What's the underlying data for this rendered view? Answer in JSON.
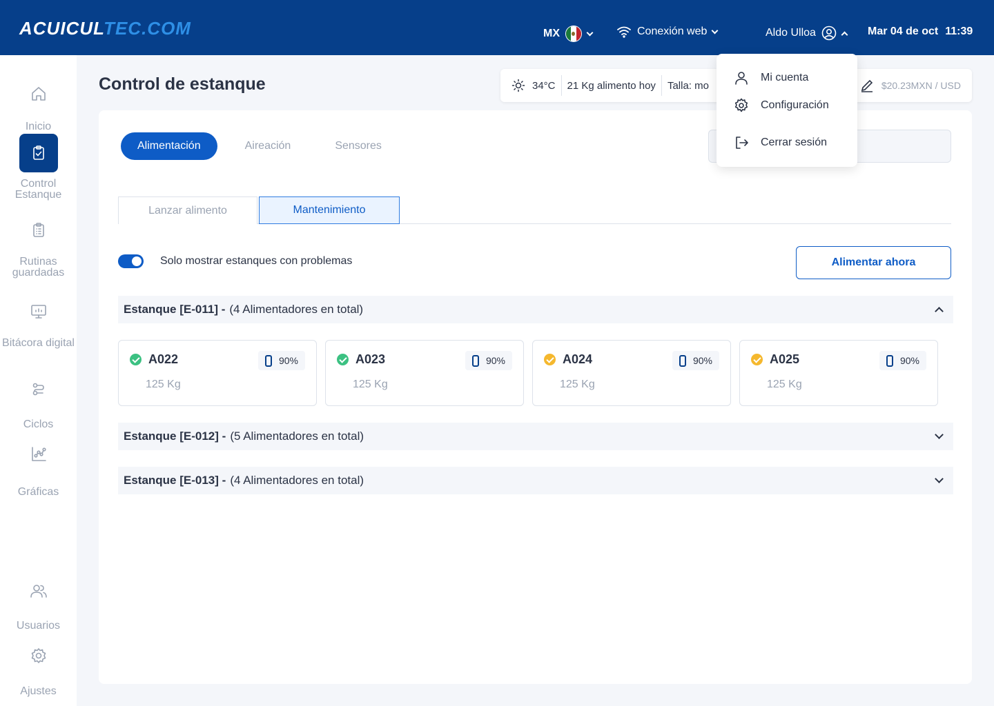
{
  "brand": {
    "logo_part1": "ACUICUL",
    "logo_part2": "TEC.COM"
  },
  "topbar": {
    "country": "MX",
    "connection": "Conexión web",
    "user": "Aldo Ulloa",
    "date": "Mar 04 de oct",
    "time": "11:39"
  },
  "sidebar": {
    "items": [
      {
        "label": "Inicio",
        "icon": "home-icon"
      },
      {
        "label": "Control Estanque",
        "icon": "clipboard-check-icon"
      },
      {
        "label": "Rutinas guardadas",
        "icon": "clipboard-list-icon"
      },
      {
        "label": "Bitácora digital",
        "icon": "monitor-icon"
      },
      {
        "label": "Ciclos",
        "icon": "route-icon"
      },
      {
        "label": "Gráficas",
        "icon": "chart-icon"
      },
      {
        "label": "Usuarios",
        "icon": "users-icon"
      },
      {
        "label": "Ajustes",
        "icon": "gear-icon"
      }
    ]
  },
  "page": {
    "title": "Control de estanque"
  },
  "info_bar": {
    "temperature": "34°C",
    "food_today": "21 Kg alimento hoy",
    "size": "Talla: mo",
    "exchange": "$20.23MXN / USD"
  },
  "tabs": {
    "feeding": "Alimentación",
    "aeration": "Aireación",
    "sensors": "Sensores"
  },
  "sub_tabs": {
    "launch": "Lanzar alimento",
    "maintenance": "Mantenimiento"
  },
  "filter": {
    "label": "Solo mostrar estanques con problemas",
    "enabled": true
  },
  "feed_now_button": "Alimentar ahora",
  "ponds": [
    {
      "id": "Estanque [E-011] -",
      "count": "(4 Alimentadores en total)",
      "expanded": true
    },
    {
      "id": "Estanque [E-012] -",
      "count": "(5 Alimentadores en total)",
      "expanded": false
    },
    {
      "id": "Estanque [E-013] -",
      "count": "(4 Alimentadores en total)",
      "expanded": false
    }
  ],
  "feeders": [
    {
      "name": "A022",
      "weight": "125 Kg",
      "battery": "90%",
      "status": "ok"
    },
    {
      "name": "A023",
      "weight": "125 Kg",
      "battery": "90%",
      "status": "ok"
    },
    {
      "name": "A024",
      "weight": "125 Kg",
      "battery": "90%",
      "status": "warning"
    },
    {
      "name": "A025",
      "weight": "125 Kg",
      "battery": "90%",
      "status": "warning"
    }
  ],
  "user_menu": {
    "account": "Mi cuenta",
    "settings": "Configuración",
    "logout": "Cerrar sesión"
  },
  "colors": {
    "primary": "#063f8a",
    "accent": "#0e5cc6",
    "ok": "#3cc182",
    "warning": "#f5b82e"
  }
}
